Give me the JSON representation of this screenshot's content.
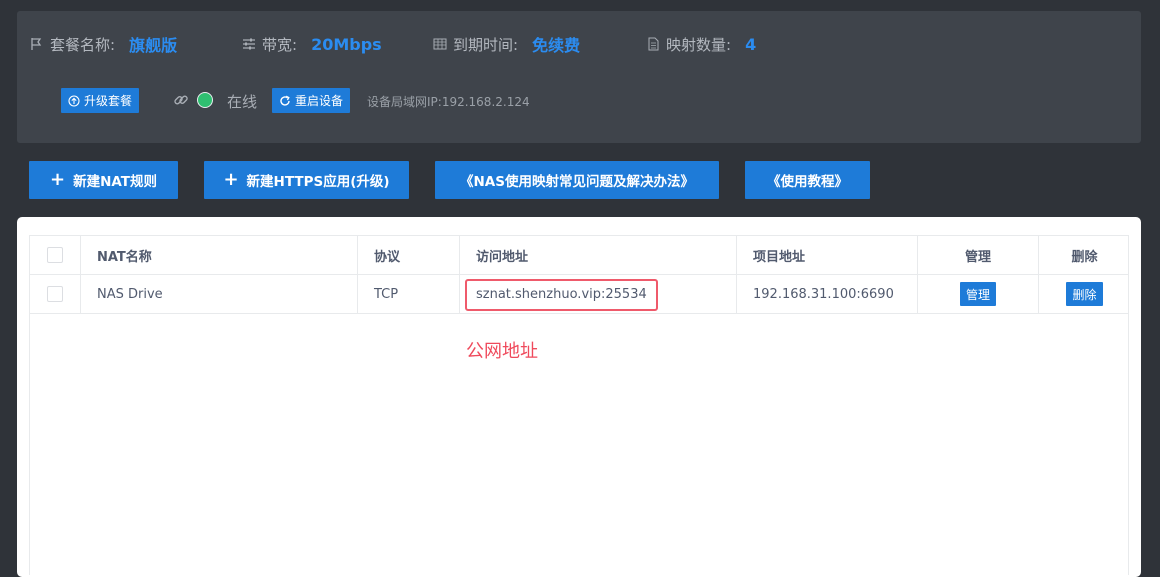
{
  "plan": {
    "package_label": "套餐名称:",
    "package_value": "旗舰版",
    "bandwidth_label": "带宽:",
    "bandwidth_value": "20Mbps",
    "expiry_label": "到期时间:",
    "expiry_value": "免续费",
    "mapping_label": "映射数量:",
    "mapping_value": "4"
  },
  "device": {
    "upgrade_label": "升级套餐",
    "status_text": "在线",
    "status_color": "#2fbf71",
    "restart_label": "重启设备",
    "lan_ip_text": "设备局域网IP:192.168.2.124"
  },
  "actions": {
    "new_nat": "新建NAT规则",
    "new_https": "新建HTTPS应用(升级)",
    "faq": "《NAS使用映射常见问题及解决办法》",
    "tutorial": "《使用教程》"
  },
  "table": {
    "headers": {
      "name": "NAT名称",
      "protocol": "协议",
      "access": "访问地址",
      "project": "项目地址",
      "manage": "管理",
      "delete": "删除"
    },
    "rows": [
      {
        "name": "NAS Drive",
        "protocol": "TCP",
        "access": "sznat.shenzhuo.vip:25534",
        "project": "192.168.31.100:6690",
        "manage": "管理",
        "delete": "删除"
      }
    ]
  },
  "annotation": {
    "text": "公网地址",
    "color": "#ef4a5c"
  },
  "colors": {
    "accent": "#1e7bd8",
    "value_blue": "#2b8cf0",
    "panel": "#3f444b",
    "background": "#2f3339"
  }
}
